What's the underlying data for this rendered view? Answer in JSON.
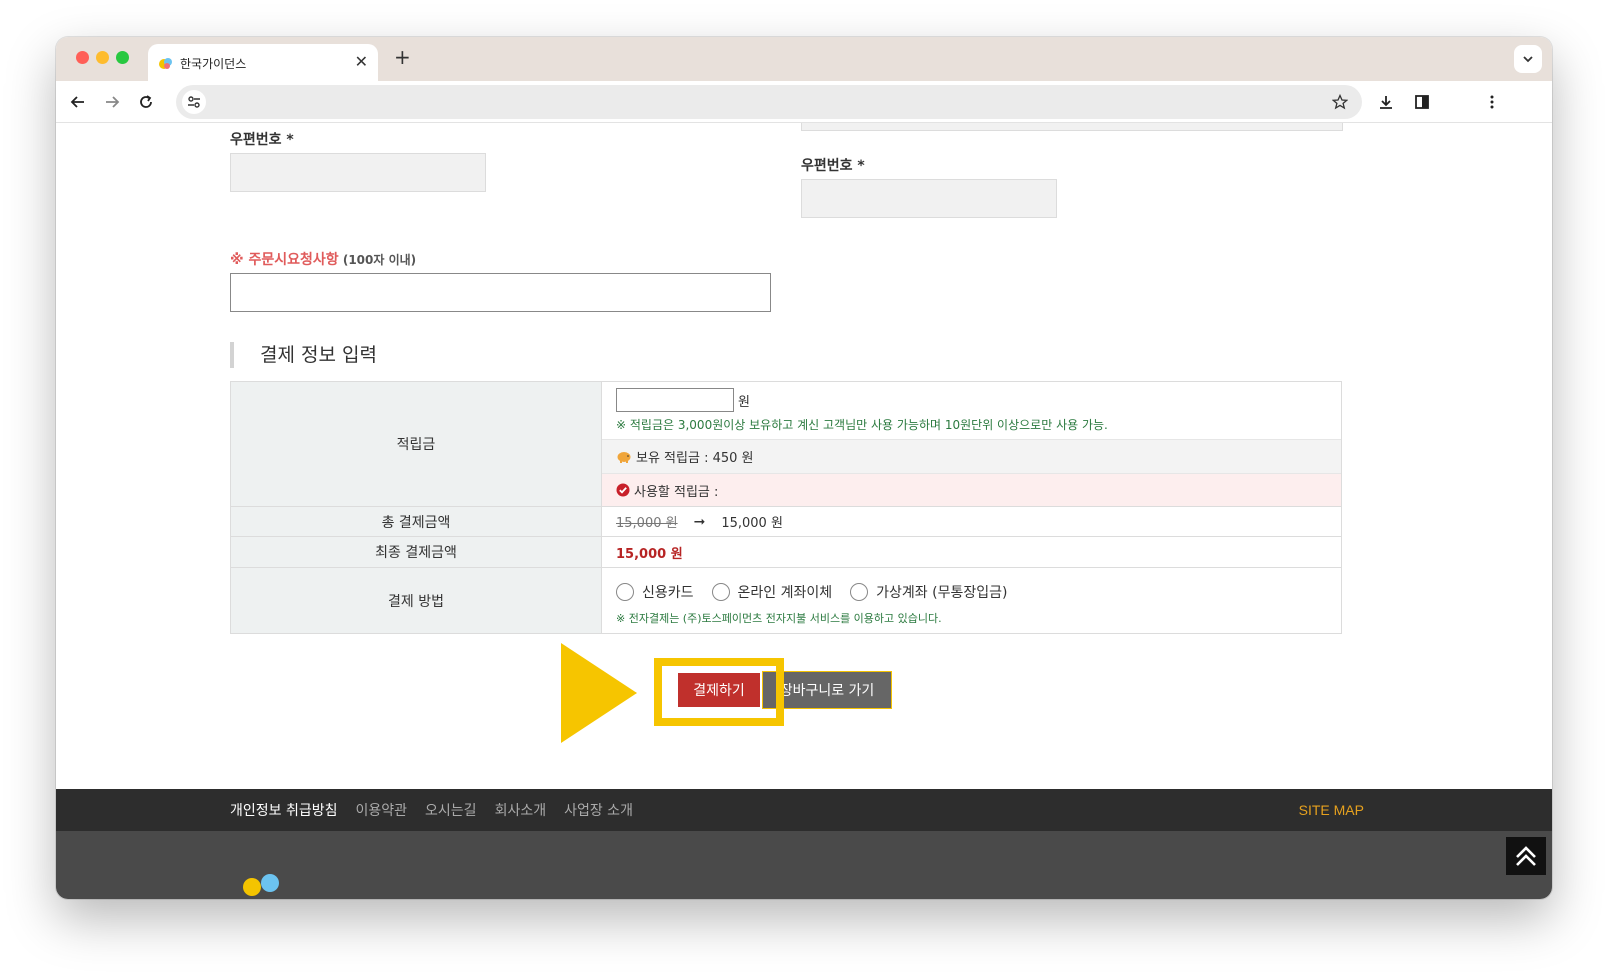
{
  "browser": {
    "tab_title": "한국가이던스",
    "tab_close": "✕",
    "new_tab": "+"
  },
  "form": {
    "postcode_label_left": "우편번호 *",
    "postcode_label_right": "우편번호 *",
    "request_label_main": "※ 주문시요청사항",
    "request_label_note": " (100자 이내)"
  },
  "payment": {
    "section_title": "결제 정보 입력",
    "points_label": "적립금",
    "points_unit": "원",
    "points_note": "※ 적립금은 3,000원이상 보유하고 계신 고객님만 사용 가능하며 10원단위 이상으로만 사용 가능.",
    "points_held": "보유 적립금 : 450 원",
    "points_use": "사용할 적립금 :",
    "total_label": "총 결제금액",
    "total_original": "15,000 원",
    "total_arrow": "➞",
    "total_value": "15,000 원",
    "final_label": "최종 결제금액",
    "final_value": "15,000 원",
    "method_label": "결제 방법",
    "methods": [
      "신용카드",
      "온라인 계좌이체",
      "가상계좌 (무통장입금)"
    ],
    "method_note": "※ 전자결제는 (주)토스페이먼츠 전자지불 서비스를 이용하고 있습니다.",
    "pay_button": "결제하기",
    "cart_button": "장바구니로 가기"
  },
  "footer": {
    "links": [
      "개인정보 취급방침",
      "이용약관",
      "오시는길",
      "회사소개",
      "사업장 소개"
    ],
    "sitemap": "SITE MAP"
  },
  "colors": {
    "highlight": "#f6c500",
    "pay_button": "#c0302c",
    "accent_green": "#2b7a3f",
    "accent_red": "#e05b5b"
  }
}
